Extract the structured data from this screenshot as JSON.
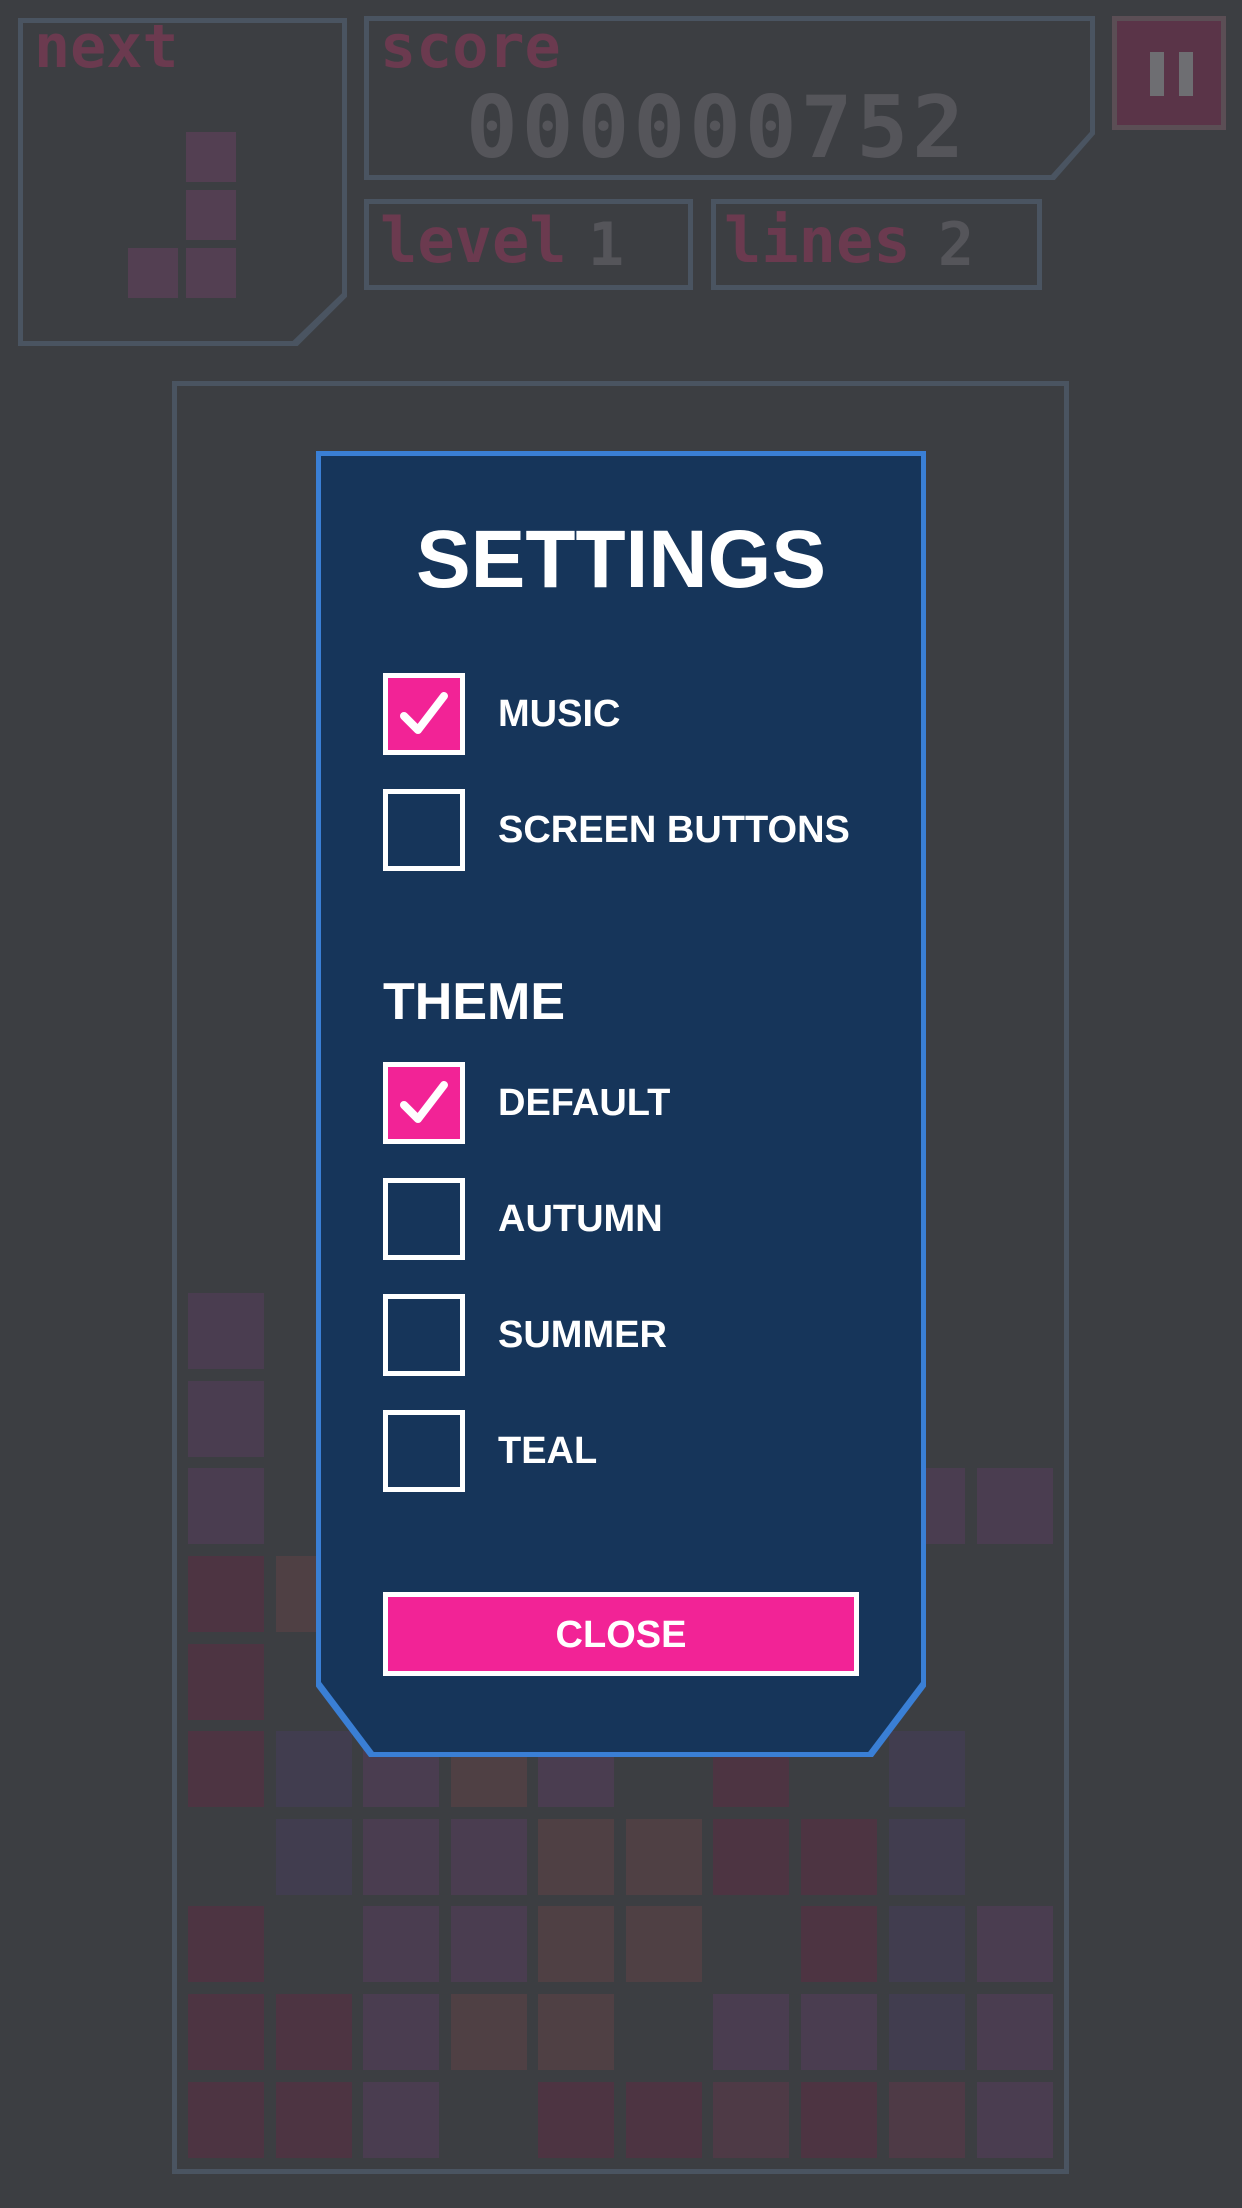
{
  "hud": {
    "next_label": "next",
    "score_label": "score",
    "score_value": "000000752",
    "level_label": "level",
    "level_value": "1",
    "lines_label": "lines",
    "lines_value": "2"
  },
  "settings": {
    "title": "SETTINGS",
    "options": [
      {
        "label": "MUSIC",
        "checked": true
      },
      {
        "label": "SCREEN BUTTONS",
        "checked": false
      }
    ],
    "theme_heading": "THEME",
    "themes": [
      {
        "label": "DEFAULT",
        "checked": true
      },
      {
        "label": "AUTUMN",
        "checked": false
      },
      {
        "label": "SUMMER",
        "checked": false
      },
      {
        "label": "TEAL",
        "checked": false
      }
    ],
    "close_label": "CLOSE"
  },
  "colors": {
    "accent_pink": "#f22396",
    "dialog_bg": "#16355a",
    "dialog_border": "#3a7fd5",
    "page_bg": "#3c3e42"
  }
}
